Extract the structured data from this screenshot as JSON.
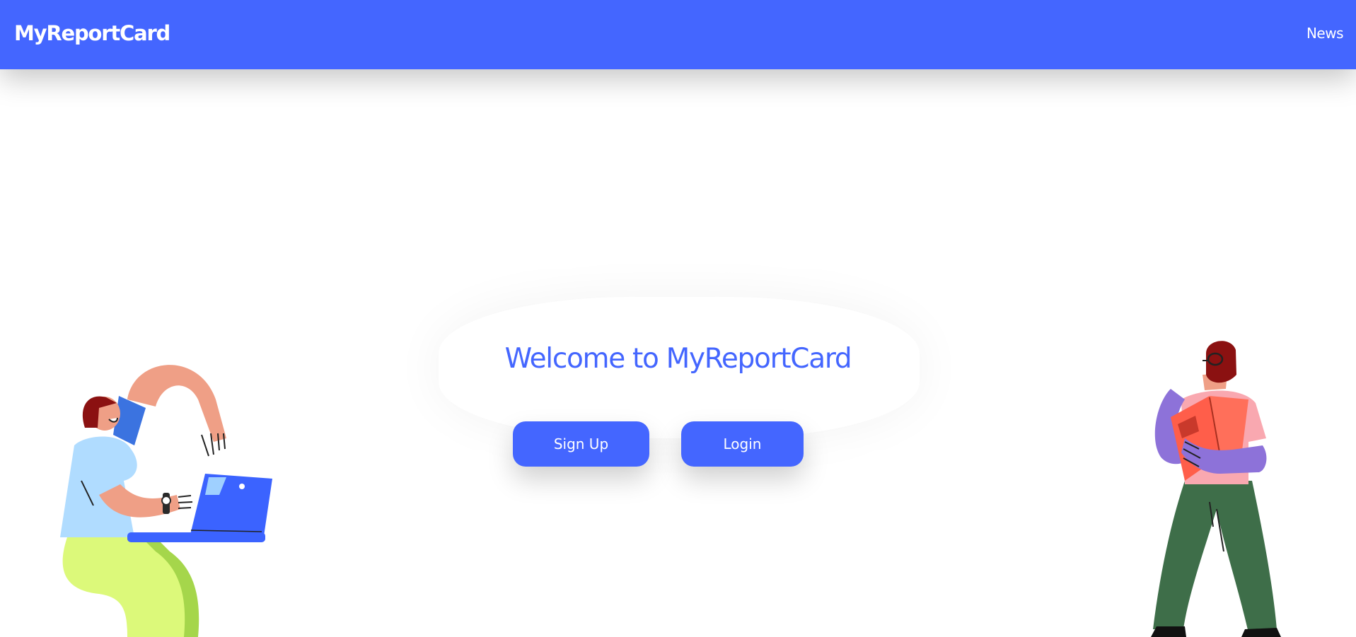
{
  "navbar": {
    "brand": "MyReportCard",
    "links": [
      {
        "label": "News"
      }
    ]
  },
  "hero": {
    "title": "Welcome to MyReportCard",
    "buttons": {
      "signup": "Sign Up",
      "login": "Login"
    }
  },
  "illustrations": {
    "left": "person-with-laptop-illustration",
    "right": "person-reading-book-illustration"
  },
  "colors": {
    "primary": "#4466ff",
    "background": "#ffffff",
    "text_on_primary": "#ffffff"
  }
}
